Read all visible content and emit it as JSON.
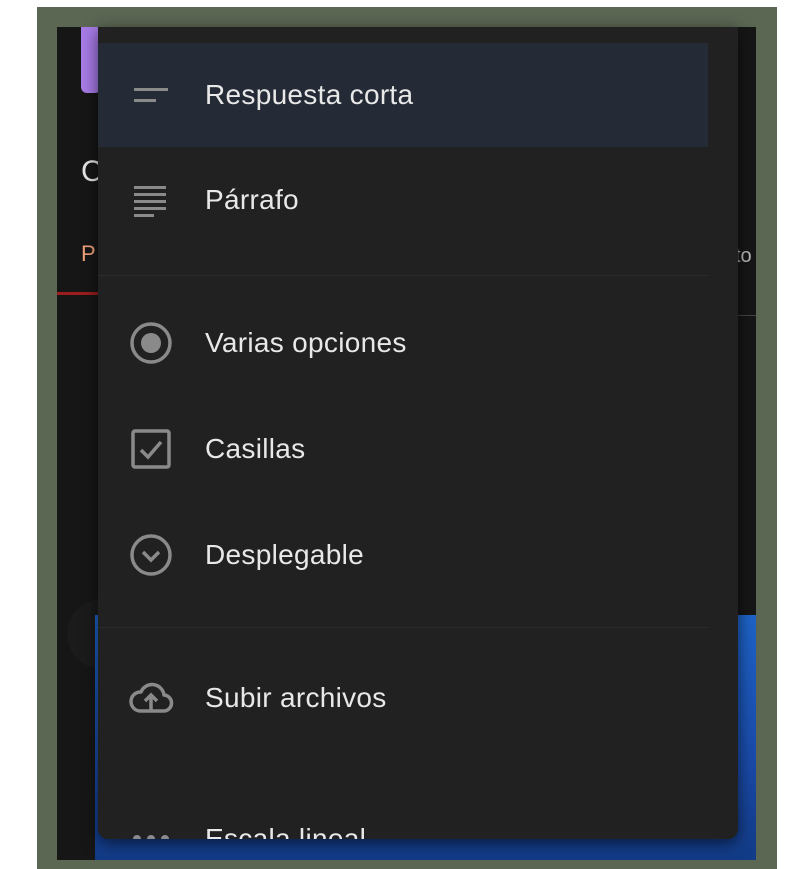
{
  "background": {
    "accent_color": "#a77be6",
    "letter_c": "C",
    "letter_p": "P",
    "partial_text": "to"
  },
  "menu": {
    "items": [
      {
        "label": "Respuesta corta",
        "icon": "short-answer-icon",
        "selected": true
      },
      {
        "label": "Párrafo",
        "icon": "paragraph-icon"
      },
      {
        "label": "Varias opciones",
        "icon": "radio-button-icon"
      },
      {
        "label": "Casillas",
        "icon": "checkbox-icon"
      },
      {
        "label": "Desplegable",
        "icon": "dropdown-circle-icon"
      },
      {
        "label": "Subir archivos",
        "icon": "cloud-upload-icon"
      },
      {
        "label": "Escala lineal",
        "icon": "linear-scale-icon"
      }
    ]
  }
}
